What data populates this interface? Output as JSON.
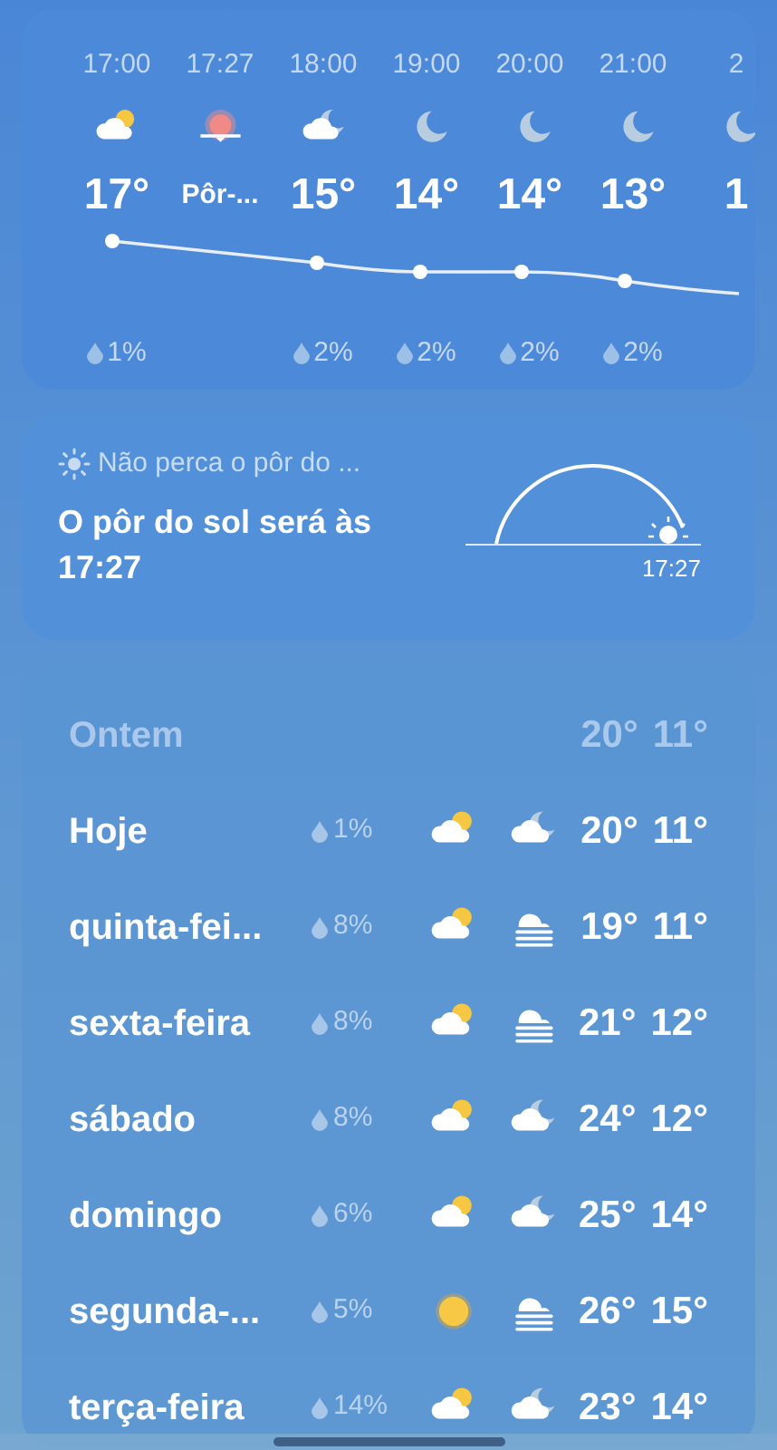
{
  "hourly": [
    {
      "time": "17:00",
      "kind": "partly-cloudy",
      "temp": "17°",
      "precip": "1%"
    },
    {
      "time": "17:27",
      "kind": "sunset",
      "temp": "Pôr-..."
    },
    {
      "time": "18:00",
      "kind": "partly-cloudy-night",
      "temp": "15°",
      "precip": "2%"
    },
    {
      "time": "19:00",
      "kind": "moon",
      "temp": "14°",
      "precip": "2%"
    },
    {
      "time": "20:00",
      "kind": "moon",
      "temp": "14°",
      "precip": "2%"
    },
    {
      "time": "21:00",
      "kind": "moon",
      "temp": "13°",
      "precip": "2%"
    },
    {
      "time": "2",
      "kind": "moon",
      "temp": "1"
    }
  ],
  "sunset": {
    "header": "Não perca o pôr do ...",
    "message": "O pôr do sol será às 17:27",
    "time": "17:27"
  },
  "daily": [
    {
      "day": "Ontem",
      "past": true,
      "high": "20°",
      "low": "11°"
    },
    {
      "day": "Hoje",
      "past": false,
      "precip": "1%",
      "icons": [
        {
          "kind": "partly-cloudy"
        },
        {
          "kind": "partly-cloudy-night"
        }
      ],
      "high": "20°",
      "low": "11°"
    },
    {
      "day": "quinta-fei...",
      "past": false,
      "precip": "8%",
      "icons": [
        {
          "kind": "partly-cloudy"
        },
        {
          "kind": "fog"
        }
      ],
      "high": "19°",
      "low": "11°"
    },
    {
      "day": "sexta-feira",
      "past": false,
      "precip": "8%",
      "icons": [
        {
          "kind": "partly-cloudy"
        },
        {
          "kind": "fog"
        }
      ],
      "high": "21°",
      "low": "12°"
    },
    {
      "day": "sábado",
      "past": false,
      "precip": "8%",
      "icons": [
        {
          "kind": "partly-cloudy"
        },
        {
          "kind": "partly-cloudy-night"
        }
      ],
      "high": "24°",
      "low": "12°"
    },
    {
      "day": "domingo",
      "past": false,
      "precip": "6%",
      "icons": [
        {
          "kind": "partly-cloudy"
        },
        {
          "kind": "partly-cloudy-night"
        }
      ],
      "high": "25°",
      "low": "14°"
    },
    {
      "day": "segunda-...",
      "past": false,
      "precip": "5%",
      "icons": [
        {
          "kind": "sun"
        },
        {
          "kind": "fog"
        }
      ],
      "high": "26°",
      "low": "15°"
    },
    {
      "day": "terça-feira",
      "past": false,
      "precip": "14%",
      "icons": [
        {
          "kind": "partly-cloudy"
        },
        {
          "kind": "partly-cloudy-night"
        }
      ],
      "high": "23°",
      "low": "14°"
    }
  ]
}
